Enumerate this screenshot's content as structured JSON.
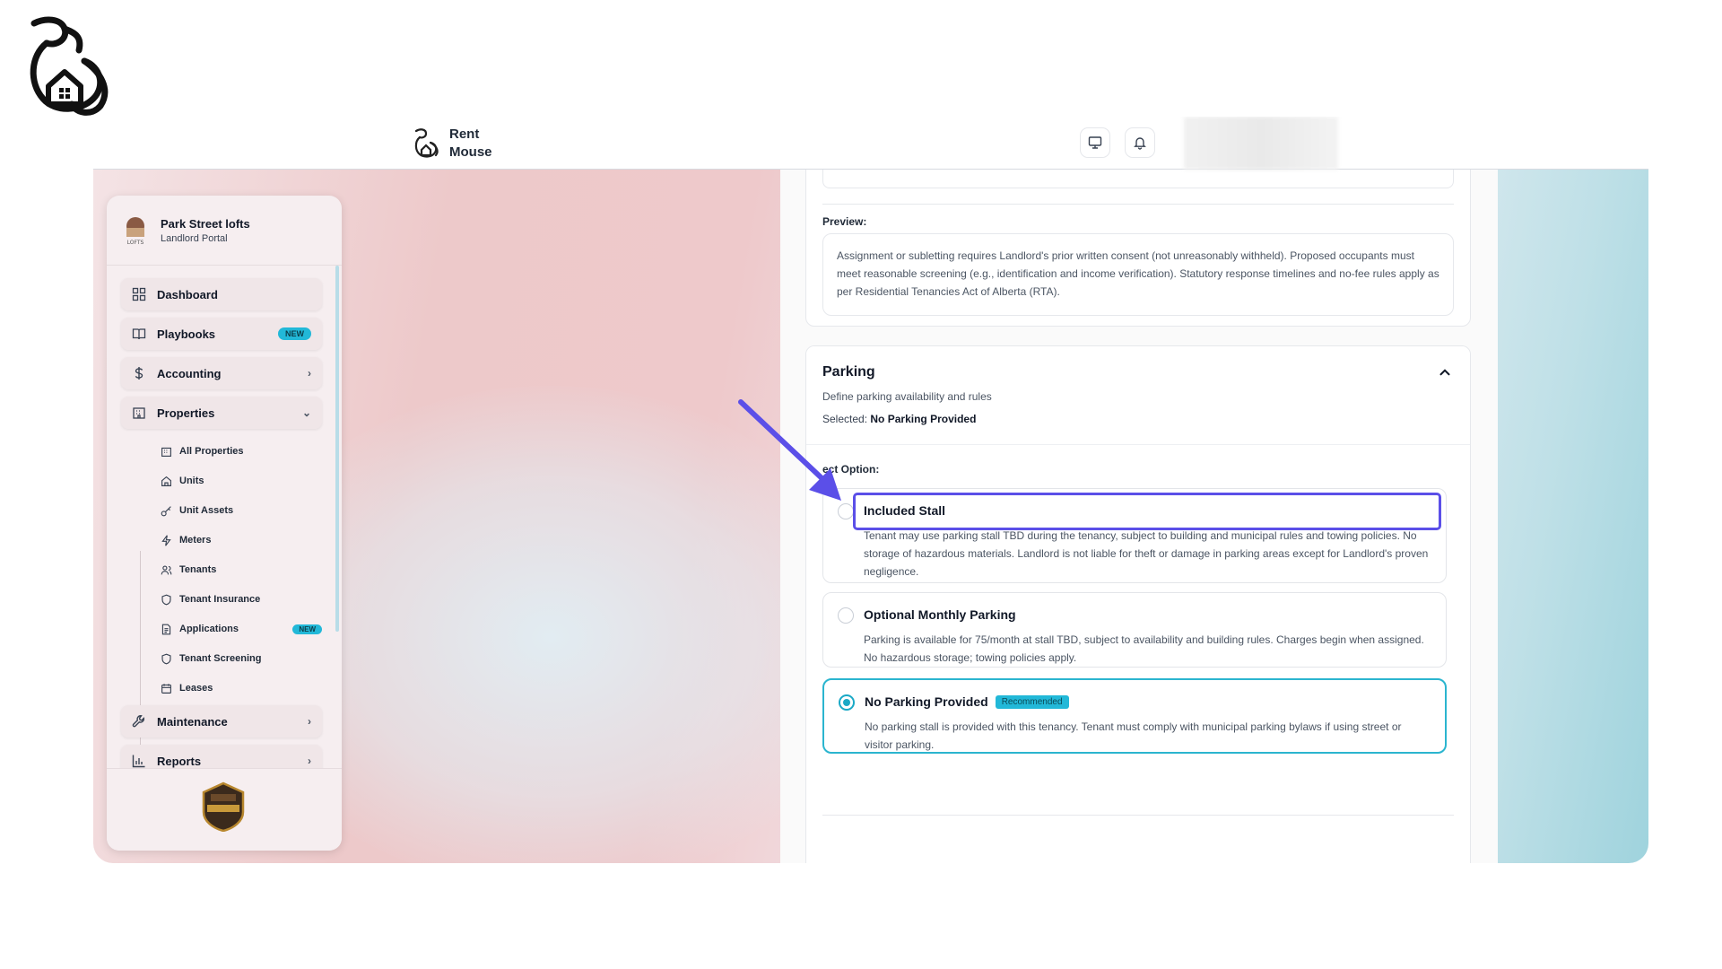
{
  "brand": {
    "name": "Rent Mouse"
  },
  "sidebar": {
    "property_name": "Park Street lofts",
    "portal": "Landlord Portal",
    "items": [
      {
        "label": "Dashboard",
        "icon": "grid-icon"
      },
      {
        "label": "Playbooks",
        "icon": "book-icon",
        "badge": "NEW"
      },
      {
        "label": "Accounting",
        "icon": "dollar-icon",
        "chevron": "›"
      },
      {
        "label": "Properties",
        "icon": "building-icon",
        "chevron": "⌄"
      },
      {
        "label": "Maintenance",
        "icon": "wrench-icon",
        "chevron": "›"
      },
      {
        "label": "Reports",
        "icon": "bar-chart-icon",
        "chevron": "›"
      }
    ],
    "sub_items": [
      {
        "label": "All Properties",
        "icon": "building-icon"
      },
      {
        "label": "Units",
        "icon": "home-icon"
      },
      {
        "label": "Unit Assets",
        "icon": "key-icon"
      },
      {
        "label": "Meters",
        "icon": "bolt-icon"
      },
      {
        "label": "Tenants",
        "icon": "users-icon"
      },
      {
        "label": "Tenant Insurance",
        "icon": "shield-icon"
      },
      {
        "label": "Applications",
        "icon": "document-icon",
        "badge": "NEW"
      },
      {
        "label": "Tenant Screening",
        "icon": "shield-icon"
      },
      {
        "label": "Leases",
        "icon": "calendar-icon"
      }
    ]
  },
  "preview": {
    "label": "Preview:",
    "text": "Assignment or subletting requires Landlord's prior written consent (not unreasonably withheld). Proposed occupants must meet reasonable screening (e.g., identification and income verification). Statutory response timelines and no-fee rules apply as per Residential Tenancies Act of Alberta (RTA)."
  },
  "parking": {
    "title": "Parking",
    "description": "Define parking availability and rules",
    "selected_label": "Selected:",
    "selected_value": "No Parking Provided",
    "select_option_label": "ect Option:",
    "options": [
      {
        "title": "Included Stall",
        "description": "Tenant may use parking stall TBD during the tenancy, subject to building and municipal rules and towing policies. No storage of hazardous materials. Landlord is not liable for theft or damage in parking areas except for Landlord's proven negligence.",
        "selected": false
      },
      {
        "title": "Optional Monthly Parking",
        "description": "Parking is available for 75/month at stall TBD, subject to availability and building rules. Charges begin when assigned. No hazardous storage; towing policies apply.",
        "selected": false
      },
      {
        "title": "No Parking Provided",
        "badge": "Recommended",
        "description": "No parking stall is provided with this tenancy. Tenant must comply with municipal parking bylaws if using street or visitor parking.",
        "selected": true
      }
    ]
  },
  "colors": {
    "accent": "#22b8d8",
    "highlight": "#5b4fe8"
  }
}
